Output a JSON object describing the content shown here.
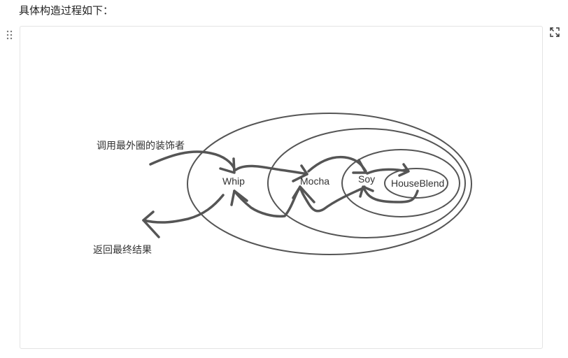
{
  "heading": "具体构造过程如下：",
  "icons": {
    "drag": "drag-handle-icon",
    "expand": "expand-icon"
  },
  "diagram": {
    "nodes": {
      "whip": "Whip",
      "mocha": "Mocha",
      "soy": "Soy",
      "houseblend": "HouseBlend"
    },
    "notes": {
      "call_outer": "调用最外圈的装饰者",
      "return_result": "返回最终结果"
    },
    "colors": {
      "stroke": "#555555",
      "text": "#333333",
      "border": "#e4e4e4"
    }
  }
}
